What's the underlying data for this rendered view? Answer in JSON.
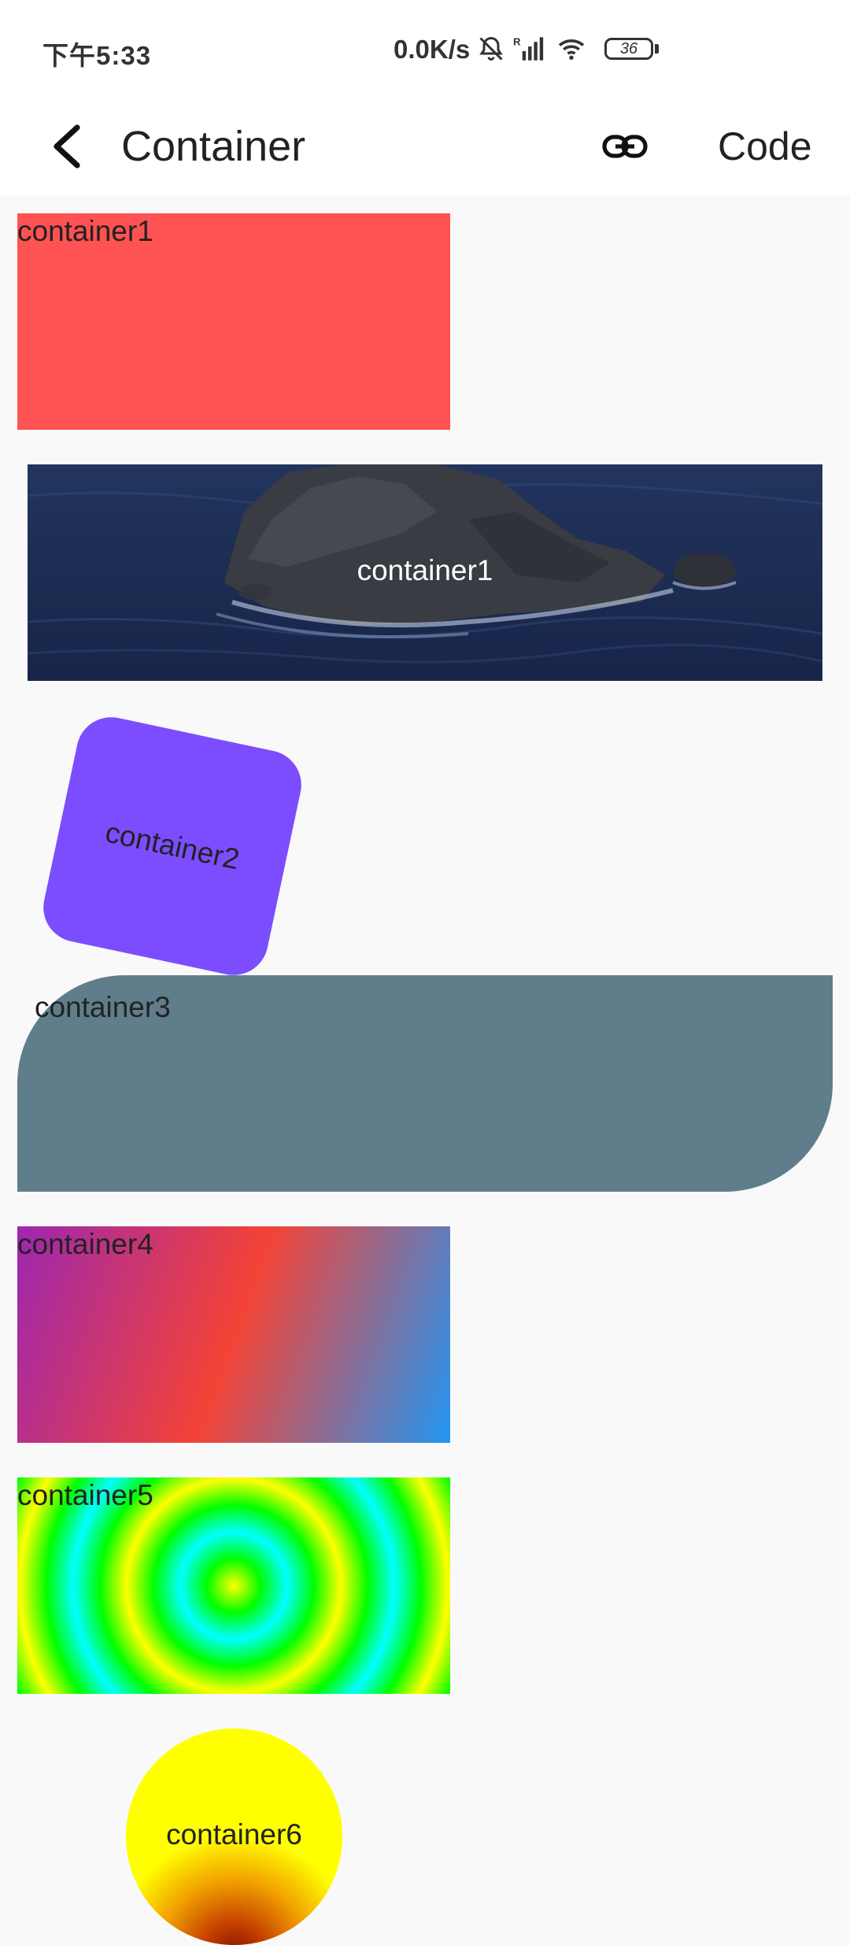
{
  "status_bar": {
    "time": "下午5:33",
    "network_speed": "0.0K/s",
    "battery": "36",
    "icons": [
      "bell-muted-icon",
      "signal-icon",
      "wifi-icon",
      "battery-icon"
    ]
  },
  "app_bar": {
    "title": "Container",
    "code_label": "Code",
    "icons": [
      "back-arrow-icon",
      "link-icon"
    ]
  },
  "containers": {
    "c1_label": "container1",
    "c1_image_label": "container1",
    "c2_label": "container2",
    "c3_label": "container3",
    "c4_label": "container4",
    "c5_label": "container5",
    "c6_label": "container6"
  },
  "colors": {
    "c1": "#ff5252",
    "c2": "#7c4dff",
    "c3": "#607d8b",
    "c4_gradient": [
      "#9c27b0",
      "#f44336",
      "#2196f3"
    ],
    "c5_gradient": [
      "#ffff00",
      "#00ff00",
      "#00ffff"
    ],
    "c6_gradient": [
      "#ffff00",
      "#f2a100",
      "#7a1500"
    ]
  }
}
